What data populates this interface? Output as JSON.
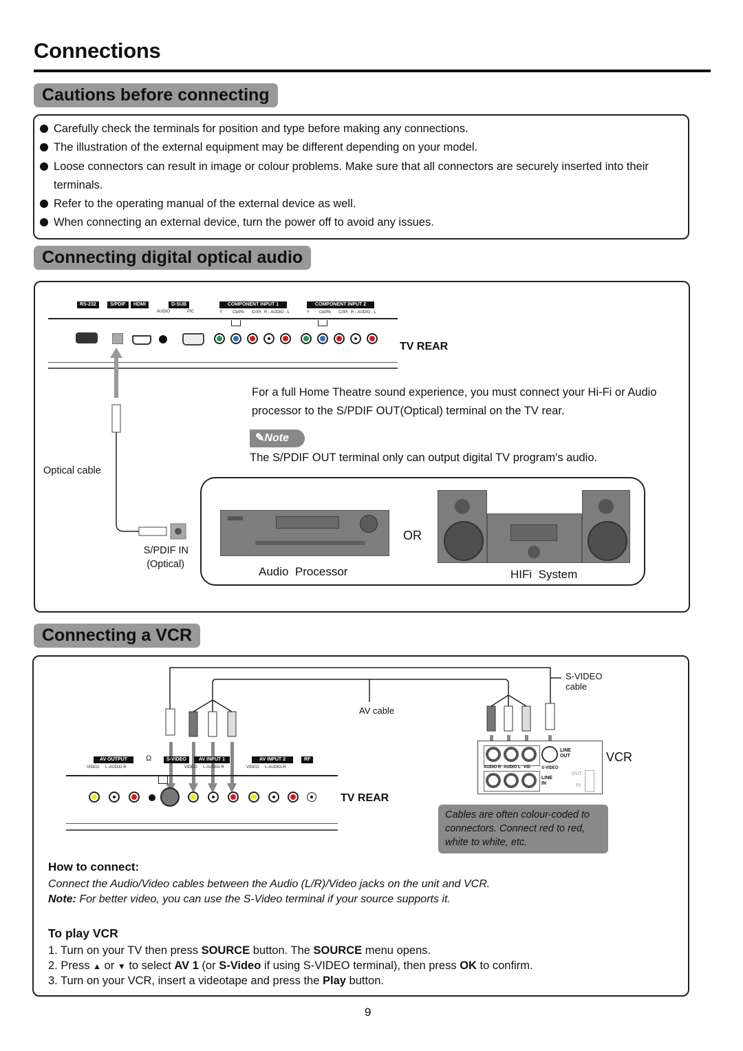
{
  "page": {
    "title": "Connections",
    "page_number": "9"
  },
  "cautions": {
    "heading": "Cautions before connecting",
    "items": [
      "Carefully check the terminals for position and type before making any connections.",
      "The illustration of the external equipment may be different depending on your model.",
      "Loose connectors can result in image or colour problems. Make sure that all connectors are securely inserted into their terminals.",
      "Refer to the operating manual of the external device as well.",
      "When connecting an external device, turn the power off to avoid any issues."
    ]
  },
  "optical": {
    "heading": "Connecting digital optical audio",
    "panel_labels": {
      "rs232": "RS-232",
      "spdif": "S/PDIF",
      "hdmi": "HDMI",
      "dsub": "D-SUB",
      "dsub_audio": "AUDIO",
      "dsub_pic": "PIC",
      "component1": "COMPONENT INPUT 1",
      "component2": "COMPONENT INPUT 2",
      "comp_y": "Y",
      "comp_cb": "Cb/Pb",
      "comp_cr": "Cr/Pr",
      "comp_audio": "R - AUDIO - L"
    },
    "tv_rear_label": "TV REAR",
    "description": "For a full Home Theatre sound experience, you must connect your Hi-Fi or Audio processor to the S/PDIF OUT(Optical) terminal on the TV rear.",
    "note_label": "Note",
    "note_text": "The S/PDIF OUT terminal only can output digital TV program's audio.",
    "cable_label": "Optical cable",
    "spdif_in_label": "S/PDIF IN",
    "spdif_in_sub": "(Optical)",
    "or_label": "OR",
    "audio_processor_label": "Audio  Processor",
    "hifi_label": "HIFi  System"
  },
  "vcr": {
    "heading": "Connecting a VCR",
    "svideo_cable_label": "S-VIDEO",
    "svideo_cable_sub": "cable",
    "av_cable_label": "AV cable",
    "tv_panel_labels": {
      "av_output": "AV OUTPUT",
      "av_output_sub": "VIDEO     L-AUDIO-R",
      "svideo": "S-VIDEO",
      "av_input1": "AV INPUT 1",
      "av_input1_sub": "VIDEO     L-AUDIO-R",
      "av_input2": "AV INPUT 2",
      "av_input2_sub": "VIDEO     L-AUDIO-R",
      "rf": "RF"
    },
    "tv_rear_label": "TV REAR",
    "vcr_label": "VCR",
    "vcr_panel_labels": {
      "line_out": "LINE\nOUT",
      "audio_r": "AUDIO R",
      "audio_l": "AUDIO L",
      "vid": "VID",
      "svideo": "S-VIDEO",
      "line_in": "LINE\nIN",
      "rf_out": "OUT",
      "rf_in": "IN"
    },
    "color_note": "Cables are often colour-coded to connectors. Connect red to red, white to white, etc.",
    "how_to_heading": "How to connect:",
    "how_to_text": "Connect the Audio/Video cables between the Audio (L/R)/Video jacks on the unit and VCR.",
    "how_to_note_label": "Note:",
    "how_to_note_text": " For better video, you can use the S-Video terminal if your source supports it.",
    "play_heading": "To play VCR",
    "steps": [
      {
        "n": "1. ",
        "parts": [
          "Turn on your TV then press ",
          "SOURCE",
          " button. The ",
          "SOURCE",
          " menu opens."
        ]
      },
      {
        "n": "2. ",
        "parts": [
          "Press ",
          "▲",
          " or ",
          "▼",
          " to select ",
          "AV 1",
          " (or ",
          "S-Video",
          " if using S-VIDEO terminal), then press ",
          "OK",
          " to confirm."
        ]
      },
      {
        "n": "3. ",
        "parts": [
          "Turn on your VCR, insert a videotape and press the ",
          "Play",
          " button."
        ]
      }
    ]
  },
  "colors": {
    "heading_bg": "#999999",
    "jack_green": "#1f9a4a",
    "jack_blue": "#2a6fd1",
    "jack_red": "#e0141b",
    "jack_white": "#ffffff",
    "jack_yellow": "#f5e800",
    "note_bg": "#8a8a8a"
  }
}
